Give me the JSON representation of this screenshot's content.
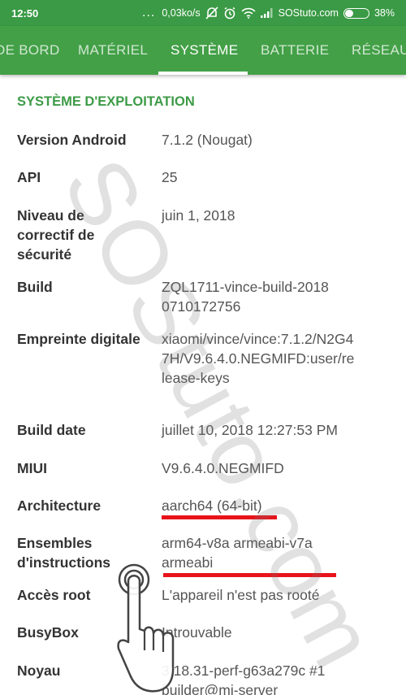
{
  "status_bar": {
    "time": "12:50",
    "dots": "...",
    "speed": "0,03ko/s",
    "carrier": "SOStuto.com",
    "battery_percent": "38%",
    "battery_level": 0.38
  },
  "tabs": [
    {
      "label": "DE BORD",
      "active": false
    },
    {
      "label": "MATÉRIEL",
      "active": false
    },
    {
      "label": "SYSTÈME",
      "active": true
    },
    {
      "label": "BATTERIE",
      "active": false
    },
    {
      "label": "RÉSEAU",
      "active": false
    }
  ],
  "section_title": "SYSTÈME D'EXPLOITATION",
  "rows": [
    {
      "label": "Version Android",
      "value": "7.1.2 (Nougat)"
    },
    {
      "label": "API",
      "value": "25"
    },
    {
      "label": "Niveau de correctif de sécurité",
      "value": "juin 1, 2018"
    },
    {
      "label": "Build",
      "value": "ZQL1711-vince-build-20180710172756"
    },
    {
      "label": "Empreinte digitale",
      "value": "xiaomi/vince/vince:7.1.2/N2G47H/V9.6.4.0.NEGMIFD:user/release-keys"
    },
    {
      "label": "Build date",
      "value": "juillet 10, 2018 12:27:53 PM"
    },
    {
      "label": "MIUI",
      "value": "V9.6.4.0.NEGMIFD"
    },
    {
      "label": "Architecture",
      "value": "aarch64 (64-bit)"
    },
    {
      "label": "Ensembles d'instructions",
      "value": "arm64-v8a armeabi-v7a armeabi"
    },
    {
      "label": "Accès root",
      "value": "L'appareil n'est pas rooté"
    },
    {
      "label": "BusyBox",
      "value": "Introuvable"
    },
    {
      "label": "Noyau",
      "value": "3.18.31-perf-g63a279c #1 builder@mi-server"
    }
  ],
  "watermark": "SOStuto.com",
  "colors": {
    "status_bar": "#3a9a45",
    "toolbar": "#43a047",
    "section_title": "#3d9b47",
    "highlight": "#e8131a"
  },
  "icons": [
    "dnd-off-icon",
    "alarm-icon",
    "wifi-icon",
    "signal-icon",
    "battery-icon",
    "pointing-hand-icon"
  ]
}
